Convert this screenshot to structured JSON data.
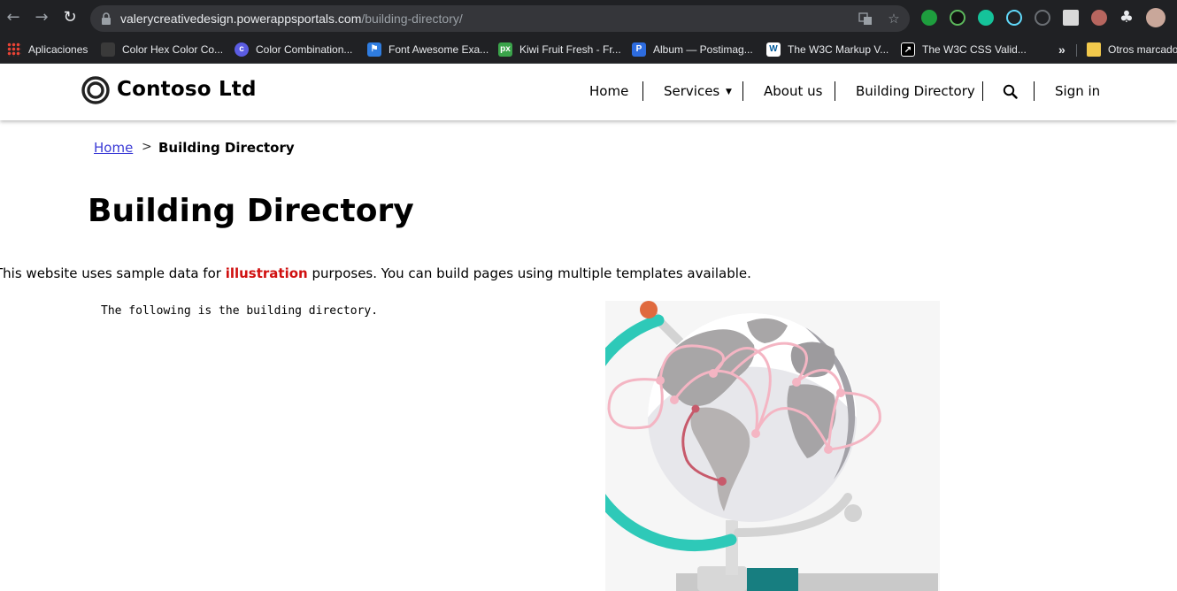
{
  "browser": {
    "url_host": "valerycreativedesign.powerappsportals.com",
    "url_path": "/building-directory/",
    "bookmarks": [
      {
        "label": "Aplicaciones",
        "icon": "apps-grid-icon"
      },
      {
        "label": "Color Hex Color Co...",
        "icon": "colorhex-favicon"
      },
      {
        "label": "Color Combination...",
        "icon": "color-combination-favicon"
      },
      {
        "label": "Font Awesome Exa...",
        "icon": "font-awesome-favicon"
      },
      {
        "label": "Kiwi Fruit Fresh - Fr...",
        "icon": "px-favicon"
      },
      {
        "label": "Album — Postimag...",
        "icon": "postimage-favicon"
      },
      {
        "label": "The W3C Markup V...",
        "icon": "w3c-favicon"
      },
      {
        "label": "The W3C CSS Valid...",
        "icon": "w3c-css-favicon"
      }
    ],
    "overflow_label": "»",
    "other_bookmarks": "Otros marcado"
  },
  "site": {
    "brand": "Contoso Ltd",
    "nav": {
      "home": "Home",
      "services": "Services",
      "about": "About us",
      "building_directory": "Building Directory",
      "sign_in": "Sign in"
    }
  },
  "breadcrumb": {
    "home": "Home",
    "separator": ">",
    "current": "Building Directory"
  },
  "page": {
    "title": "Building Directory",
    "intro_before": "This website uses sample data for ",
    "intro_highlight": "illustration",
    "intro_after": " purposes. You can build pages using multiple templates available.",
    "code_text": "The following is the building directory."
  },
  "colors": {
    "accent_red": "#d01010",
    "link_blue": "#3b3bd6",
    "globe_teal": "#2ec9b8",
    "route_pink": "#f4b5c3"
  }
}
